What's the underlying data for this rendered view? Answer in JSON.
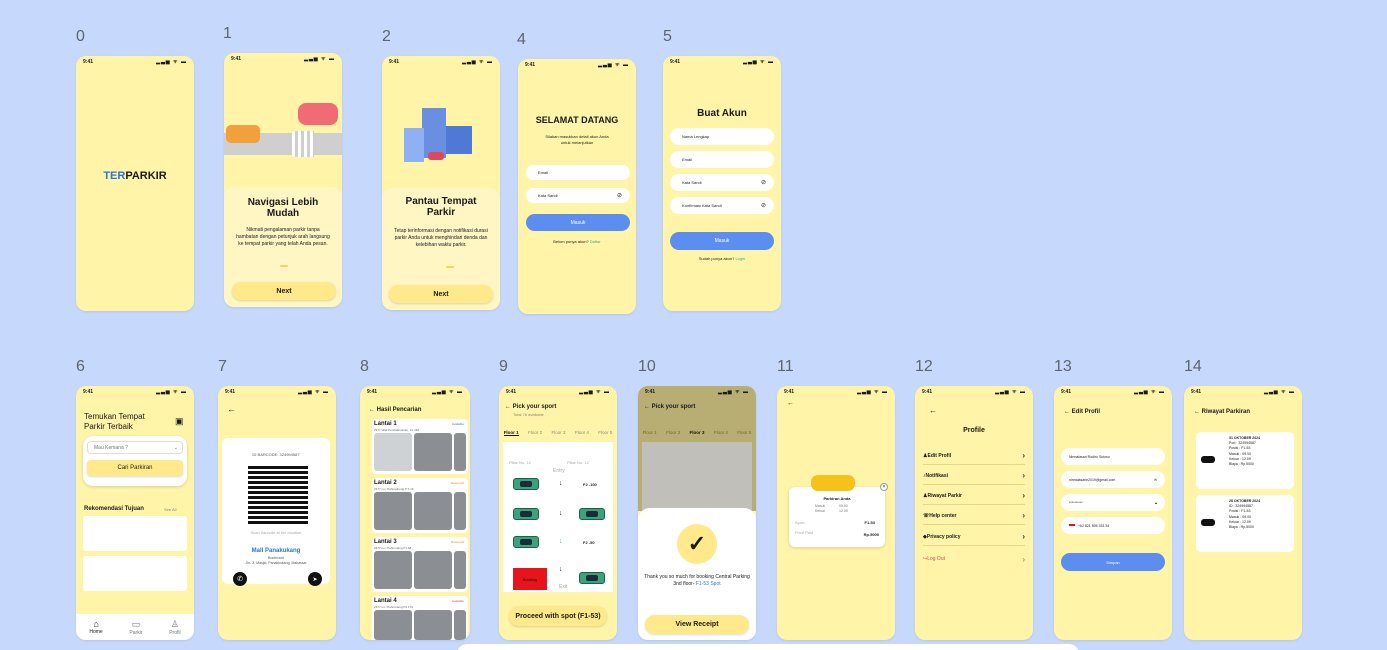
{
  "frame_labels": [
    "0",
    "1",
    "2",
    "4",
    "5",
    "6",
    "7",
    "8",
    "9",
    "10",
    "11",
    "12",
    "13",
    "14"
  ],
  "status_time": "9:41",
  "status_icons": "▂▃▅ ᯤ ▬",
  "brand": {
    "part1": "TER",
    "part2": "PARKIR",
    "color_primary": "#2f6fe0",
    "color_secondary": "#1a1a1a"
  },
  "onboarding1": {
    "title": "Navigasi Lebih Mudah",
    "body": "Nikmati pengalaman parkir tanpa hambatan dengan petunjuk arah langsung ke tempat parkir yang telah Anda pesan.",
    "button": "Next"
  },
  "onboarding2": {
    "title": "Pantau Tempat Parkir",
    "body": "Tetap terinformasi dengan notifikasi durasi parkir Anda untuk menghindari denda dan kelebihan waktu parkir.",
    "button": "Next"
  },
  "login": {
    "title": "SELAMAT DATANG",
    "subtitle": "Silakan masukkan detail akun Anda untuk melanjutkan",
    "email_placeholder": "Email",
    "password_placeholder": "Kata Sandi",
    "button": "Masuk",
    "footer": "Belum punya akun?",
    "footer_link": "Daftar"
  },
  "register": {
    "title": "Buat Akun",
    "name": "Nama Lengkap",
    "email": "Email",
    "password": "Kata Sandi",
    "confirm": "Konfirmasi Kata Sandi",
    "button": "Masuk",
    "footer": "Sudah punya akun?",
    "footer_link": "Login"
  },
  "home": {
    "title": "Temukan Tempat Parkir Terbaik",
    "select": "Mau Kemana ?",
    "search_button": "Cari Parkiran",
    "section": "Rekomendasi Tujuan",
    "see_all": "See All",
    "nav": [
      "Home",
      "Parkir",
      "Profil"
    ]
  },
  "barcode": {
    "id": "ID BARCODE: 324994587",
    "scan_hint": "Scan barcode at the location",
    "place": "Mall Panakukang",
    "place_sub": "Boulevard",
    "address": "Jln. Jl. Masjid, Panakkukang, Makassar"
  },
  "search": {
    "title": "Hasil Pencarian",
    "items": [
      {
        "name": "Lantai 1",
        "addr": "2377 Wali Pendalamanku, KL 140",
        "tag": "Available"
      },
      {
        "name": "Lantai 2",
        "addr": "2377 nu i Pahnadrunig P.7-19",
        "tag": "Reserved"
      },
      {
        "name": "Lantai 3",
        "addr": "2377 nu i Pahnrulang PJ-68",
        "tag": "Reserved"
      },
      {
        "name": "Lantai 4",
        "addr": "2377 nu i Pahnrulang P4 179",
        "tag": "Available"
      }
    ]
  },
  "spot": {
    "title": "Pick your sport",
    "sub": "Total 78 available",
    "floors": [
      "Floor 1",
      "Floor 2",
      "Floor 3",
      "Floor 4",
      "Floor 5"
    ],
    "pillar": "Pillar No. 12",
    "entry": "Entry",
    "exit": "Exit",
    "labels": [
      "F2 -100",
      "F2 -50"
    ],
    "booked": "Booking",
    "button": "Proceed with spot (F1-53)"
  },
  "success": {
    "msg": "Thank you so much for booking Central Parking 3nd floor-",
    "spot": "F1-53 Spot",
    "button": "View Receipt"
  },
  "receipt": {
    "title": "Parkiran Anda",
    "masuk_l": "Masuk",
    "masuk_v": "09.00",
    "keluar_l": "Keluar",
    "keluar_v": "12.09",
    "sport_l": "Sport :",
    "sport_v": "F1-53",
    "price_l": "Price Paid",
    "price_v": "Rp.5000"
  },
  "profile": {
    "title": "Profile",
    "items": [
      "Edit Profil",
      "Notifikasi",
      "Riwayat Parkir",
      "Help center",
      "Privacy policy",
      "Log Out"
    ]
  },
  "edit": {
    "title": "Edit Profil",
    "name": "Nirmalasari Rodiro Sutoso",
    "email": "nirmalasarie2019@gmail.com",
    "password": "**********",
    "phone": "+62 821 895 333 34",
    "button": "Simpan"
  },
  "history": {
    "title": "Riwayat Parkiran",
    "entries": [
      {
        "date": "31 OKTOBER 2024",
        "id": "Port : 324994587",
        "pos": "Posisi : F1-53",
        "in": "Masuk : 09.00",
        "out": "Keluar : 12.09",
        "cost": "Biaya : Rp.5000"
      },
      {
        "date": "28 OKTOBER 2024",
        "id": "ID : 324994587",
        "pos": "Posisi : F1-53",
        "in": "Masuk : 09.00",
        "out": "Keluar : 12.09",
        "cost": "Biaya : Rp.5000"
      }
    ]
  }
}
